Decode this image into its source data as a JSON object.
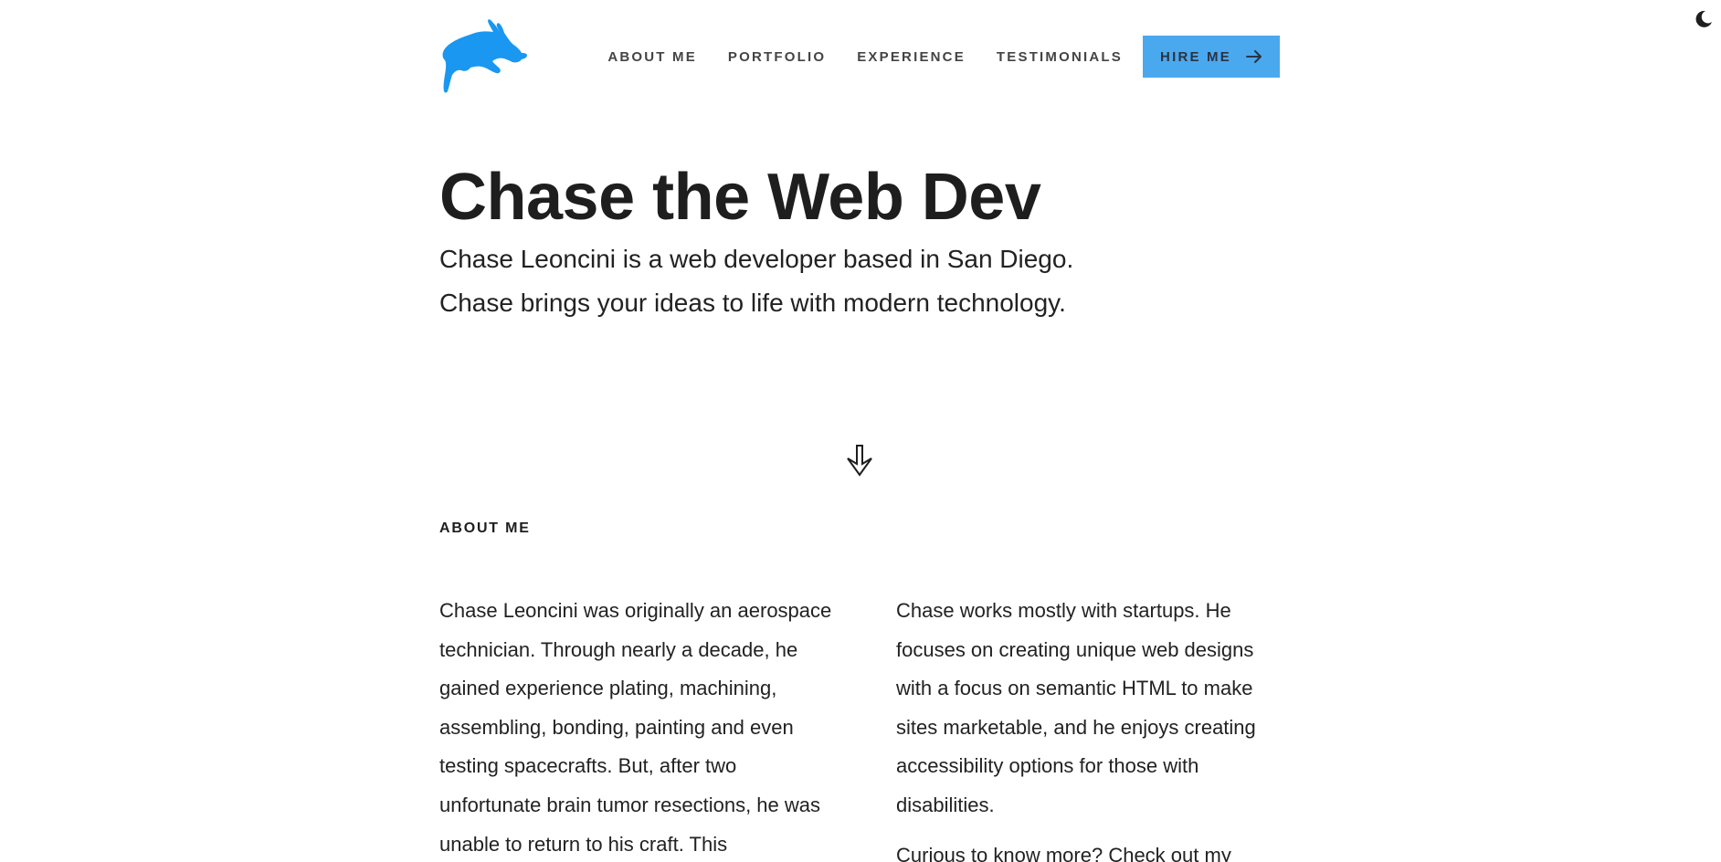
{
  "theme_toggle": {
    "icon": "moon-icon"
  },
  "logo": {
    "icon": "rabbit-logo-icon",
    "color": "#1a97f0"
  },
  "nav": {
    "links": [
      {
        "label": "ABOUT ME"
      },
      {
        "label": "PORTFOLIO"
      },
      {
        "label": "EXPERIENCE"
      },
      {
        "label": "TESTIMONIALS"
      }
    ],
    "hire_label": "HIRE ME",
    "hire_color": "#4aa8ef"
  },
  "hero": {
    "title": "Chase the Web Dev",
    "subtitle_line1": "Chase Leoncini is a web developer based in San Diego.",
    "subtitle_line2": "Chase brings your ideas to life with modern technology."
  },
  "about": {
    "heading": "ABOUT ME",
    "left_paragraph": "Chase Leoncini was originally an aerospace technician. Through nearly a decade, he gained experience plating, machining, assembling, bonding, painting and even testing spacecrafts. But, after two unfortunate brain tumor resections, he was unable to return to his craft. This",
    "right_paragraph_1": "Chase works mostly with startups. He focuses on creating unique web designs with a focus on semantic HTML to make sites marketable, and he enjoys creating accessibility options for those with disabilities.",
    "right_paragraph_2": "Curious to know more? Check out my"
  }
}
